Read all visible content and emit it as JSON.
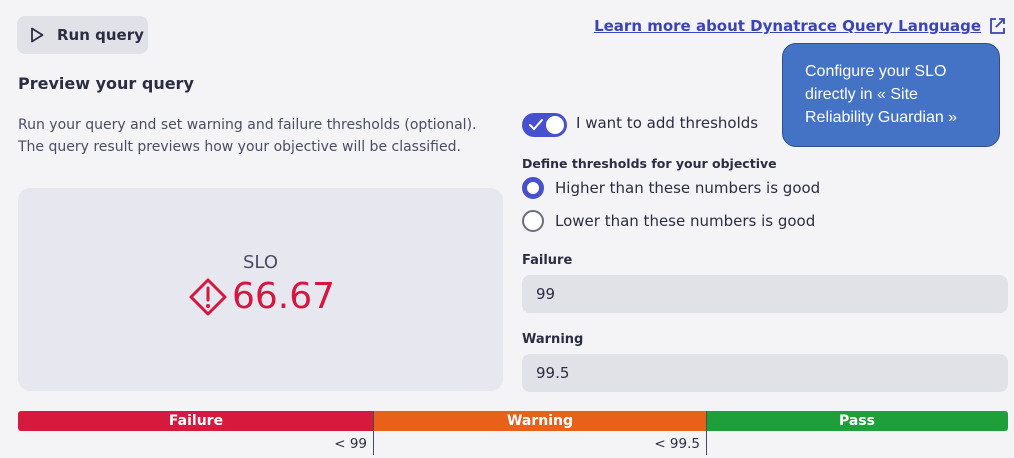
{
  "toolbar": {
    "run_label": "Run query",
    "learn_more_link": "Learn more about Dynatrace Query Language"
  },
  "preview": {
    "title": "Preview your query",
    "description_line1": "Run your query and set warning and failure thresholds (optional).",
    "description_line2": "The query result previews how your objective will be classified.",
    "slo_label": "SLO",
    "slo_value": "66.67",
    "slo_status_color": "#d6163f"
  },
  "thresholds": {
    "toggle_label": "I want to add thresholds",
    "toggle_on": true,
    "define_label": "Define thresholds for your objective",
    "options": [
      {
        "label": "Higher than these numbers is good",
        "selected": true
      },
      {
        "label": "Lower than these numbers is good",
        "selected": false
      }
    ],
    "failure_label": "Failure",
    "failure_value": "99",
    "warning_label": "Warning",
    "warning_value": "99.5"
  },
  "callout": {
    "line1": "Configure your SLO",
    "line2": "directly in «  Site",
    "line3": "Reliability Guardian »"
  },
  "status_bar": {
    "segments": [
      {
        "label": "Failure",
        "color": "#d61a3e"
      },
      {
        "label": "Warning",
        "color": "#e8611a"
      },
      {
        "label": "Pass",
        "color": "#1e9f3a"
      }
    ],
    "failure_tick": "< 99",
    "warning_tick": "< 99.5"
  },
  "icons": {
    "run": "play-icon",
    "external": "external-link-icon",
    "status": "warning-diamond-icon",
    "toggle": "check-icon"
  }
}
